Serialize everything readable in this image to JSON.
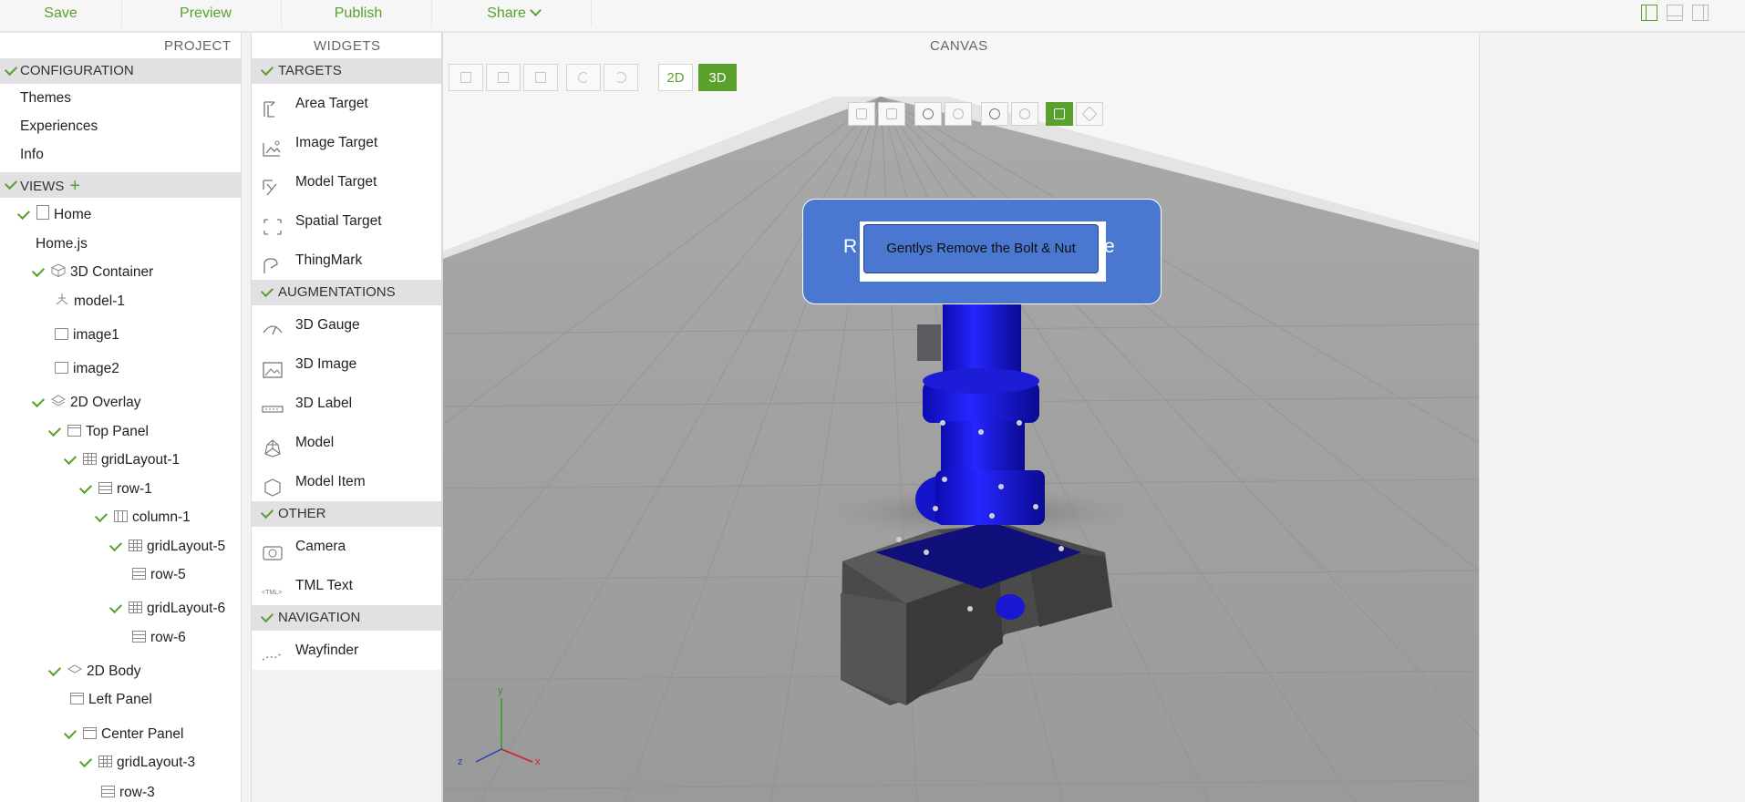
{
  "toolbar": {
    "save": "Save",
    "preview": "Preview",
    "publish": "Publish",
    "share": "Share"
  },
  "project": {
    "title": "PROJECT",
    "configuration": {
      "label": "CONFIGURATION",
      "items": [
        "Themes",
        "Experiences",
        "Info"
      ]
    },
    "views": {
      "label": "VIEWS",
      "tree": {
        "home": "Home",
        "home_js": "Home.js",
        "container3d": "3D Container",
        "model1": "model-1",
        "image1": "image1",
        "image2": "image2",
        "overlay2d": "2D Overlay",
        "top_panel": "Top Panel",
        "gridlayout1": "gridLayout-1",
        "row1": "row-1",
        "column1": "column-1",
        "gridlayout5": "gridLayout-5",
        "row5": "row-5",
        "gridlayout6": "gridLayout-6",
        "row6": "row-6",
        "body2d": "2D Body",
        "left_panel": "Left Panel",
        "center_panel": "Center Panel",
        "gridlayout3": "gridLayout-3",
        "row3": "row-3"
      }
    }
  },
  "widgets": {
    "title": "WIDGETS",
    "groups": [
      {
        "label": "TARGETS",
        "items": [
          "Area Target",
          "Image Target",
          "Model Target",
          "Spatial Target",
          "ThingMark"
        ]
      },
      {
        "label": "AUGMENTATIONS",
        "items": [
          "3D Gauge",
          "3D Image",
          "3D Label",
          "Model",
          "Model Item"
        ]
      },
      {
        "label": "OTHER",
        "items": [
          "Camera",
          "TML Text"
        ]
      },
      {
        "label": "NAVIGATION",
        "items": [
          "Wayfinder"
        ]
      }
    ]
  },
  "canvas": {
    "title": "CANVAS",
    "mode_2d": "2D",
    "mode_3d": "3D",
    "active_mode": "3D",
    "label_left": "R",
    "label_right": "e",
    "button_text": "Gentlys Remove the Bolt & Nut",
    "axes": {
      "x": "x",
      "y": "y",
      "z": "z"
    }
  },
  "colors": {
    "accent": "#5aa02c",
    "panel_blue": "#4a78d0",
    "pump_blue": "#1a1ae0"
  }
}
